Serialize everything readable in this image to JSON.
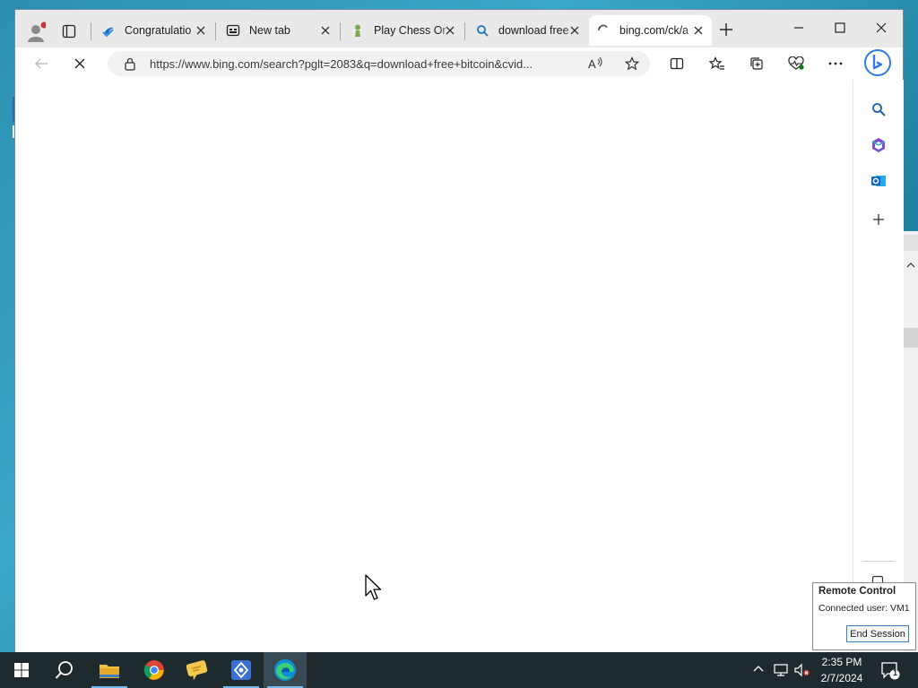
{
  "browser": {
    "tabs": [
      {
        "title": "Congratulatio",
        "icon": "bing-icon",
        "active": false
      },
      {
        "title": "New tab",
        "icon": "new-tab-icon",
        "active": false
      },
      {
        "title": "Play Chess Or",
        "icon": "chess-pawn-icon",
        "active": false
      },
      {
        "title": "download free",
        "icon": "search-icon",
        "active": false
      },
      {
        "title": "bing.com/ck/a",
        "icon": "loading-spinner-icon",
        "active": true
      }
    ],
    "url": "https://www.bing.com/search?pglt=2083&q=download+free+bitcoin&cvid...",
    "sidebar_icons": [
      "bing-copilot-icon",
      "search-icon",
      "office-icon",
      "outlook-icon",
      "add-icon"
    ]
  },
  "remote_control": {
    "title": "Remote Control",
    "status": "Connected user: VM1",
    "end_button": "End Session"
  },
  "taskbar": {
    "apps": [
      "start-icon",
      "search-icon",
      "file-explorer-icon",
      "chrome-icon",
      "chat-bubble-icon",
      "generic-app-icon",
      "edge-icon"
    ],
    "time": "2:35 PM",
    "date": "2/7/2024",
    "notification_count": "1"
  },
  "colors": {
    "accent": "#0078d4",
    "taskbar": "#1f2a2f"
  }
}
